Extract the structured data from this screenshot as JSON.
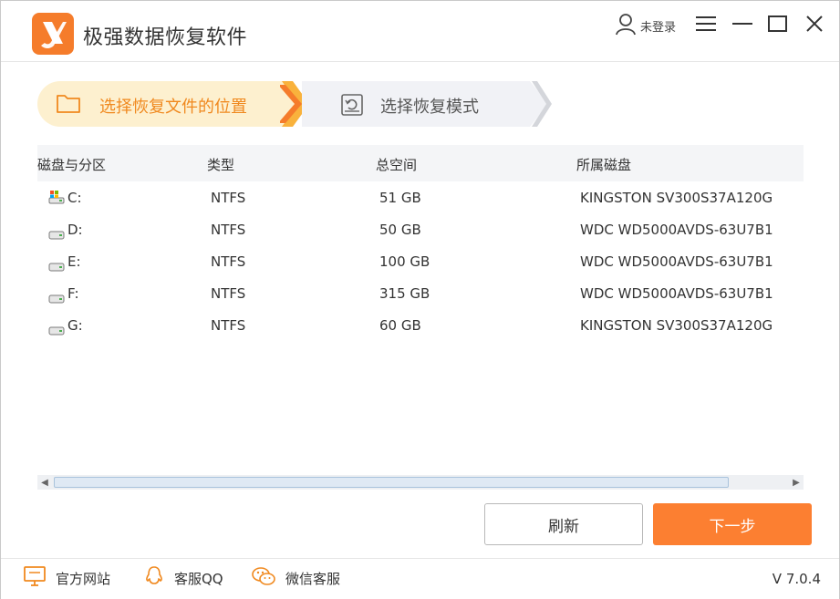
{
  "app": {
    "title": "极强数据恢复软件",
    "version": "V 7.0.4"
  },
  "titlebar": {
    "user_label": "未登录"
  },
  "steps": [
    {
      "label": "选择恢复文件的位置",
      "active": true
    },
    {
      "label": "选择恢复模式",
      "active": false
    }
  ],
  "table": {
    "headers": [
      "磁盘与分区",
      "类型",
      "总空间",
      "所属磁盘"
    ],
    "rows": [
      {
        "partition": "C:",
        "type": "NTFS",
        "size": "51 GB",
        "disk": "KINGSTON SV300S37A120G",
        "icon": "system-drive-icon"
      },
      {
        "partition": "D:",
        "type": "NTFS",
        "size": "50 GB",
        "disk": "WDC WD5000AVDS-63U7B1",
        "icon": "drive-icon"
      },
      {
        "partition": "E:",
        "type": "NTFS",
        "size": "100 GB",
        "disk": "WDC WD5000AVDS-63U7B1",
        "icon": "drive-icon"
      },
      {
        "partition": "F:",
        "type": "NTFS",
        "size": "315 GB",
        "disk": "WDC WD5000AVDS-63U7B1",
        "icon": "drive-icon"
      },
      {
        "partition": "G:",
        "type": "NTFS",
        "size": "60 GB",
        "disk": "KINGSTON SV300S37A120G",
        "icon": "drive-icon"
      }
    ]
  },
  "buttons": {
    "refresh": "刷新",
    "next": "下一步"
  },
  "footer": {
    "website": "官方网站",
    "qq": "客服QQ",
    "wechat": "微信客服"
  },
  "colors": {
    "accent": "#fc7f31",
    "step_active_bg": "#fdf0cf",
    "step_active_text": "#f0891f",
    "step_inactive_bg": "#f1f2f6"
  }
}
